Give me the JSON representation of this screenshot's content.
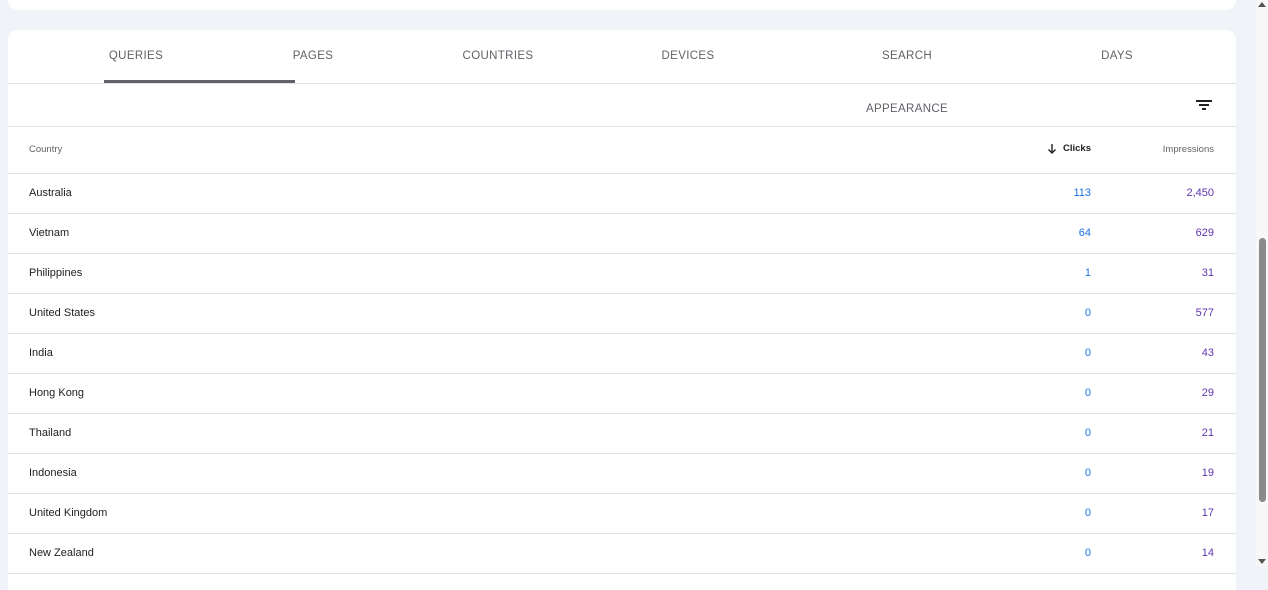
{
  "tabs": [
    {
      "label": "QUERIES",
      "active": true
    },
    {
      "label": "PAGES",
      "active": false
    },
    {
      "label": "COUNTRIES",
      "active": false
    },
    {
      "label": "DEVICES",
      "active": false
    },
    {
      "label": "SEARCH APPEARANCE",
      "active": false
    },
    {
      "label": "DAYS",
      "active": false
    }
  ],
  "icons": {
    "filter": "filter-icon",
    "sort": "arrow-down-icon"
  },
  "table": {
    "headers": {
      "country": "Country",
      "clicks": "Clicks",
      "impressions": "Impressions"
    },
    "sorted_by": "Clicks",
    "rows": [
      {
        "country": "Australia",
        "clicks": "113",
        "impressions": "2,450"
      },
      {
        "country": "Vietnam",
        "clicks": "64",
        "impressions": "629"
      },
      {
        "country": "Philippines",
        "clicks": "1",
        "impressions": "31"
      },
      {
        "country": "United States",
        "clicks": "0",
        "impressions": "577"
      },
      {
        "country": "India",
        "clicks": "0",
        "impressions": "43"
      },
      {
        "country": "Hong Kong",
        "clicks": "0",
        "impressions": "29"
      },
      {
        "country": "Thailand",
        "clicks": "0",
        "impressions": "21"
      },
      {
        "country": "Indonesia",
        "clicks": "0",
        "impressions": "19"
      },
      {
        "country": "United Kingdom",
        "clicks": "0",
        "impressions": "17"
      },
      {
        "country": "New Zealand",
        "clicks": "0",
        "impressions": "14"
      }
    ]
  },
  "colors": {
    "clicks": "#1a73e8",
    "impressions": "#5e35b1",
    "background": "#f0f4f9"
  }
}
